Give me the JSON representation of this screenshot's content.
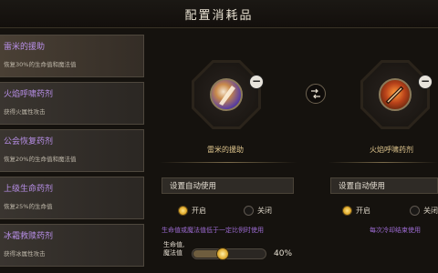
{
  "title": "配置消耗品",
  "consumables": [
    {
      "name": "雷米的援助",
      "desc": "恢复30%的生命值和魔法值"
    },
    {
      "name": "火焰呼啸药剂",
      "desc": "获得火属性攻击"
    },
    {
      "name": "公会恢复药剂",
      "desc": "恢复20%的生命值和魔法值"
    },
    {
      "name": "上级生命药剂",
      "desc": "恢复25%的生命值"
    },
    {
      "name": "冰霜救赎药剂",
      "desc": "获得冰属性攻击"
    }
  ],
  "slot1": {
    "name": "雷米的援助",
    "auto_label": "设置自动使用",
    "on_label": "开启",
    "off_label": "关闭",
    "selected": "on",
    "hint": "生命值或魔法值低于一定比例时使用",
    "threshold_label_line1": "生命值,",
    "threshold_label_line2": "魔法值",
    "threshold_value": "40%",
    "threshold_fraction": 0.4
  },
  "slot2": {
    "name": "火焰呼啸药剂",
    "auto_label": "设置自动使用",
    "on_label": "开启",
    "off_label": "关闭",
    "selected": "on",
    "hint": "每次冷却结束使用"
  },
  "icons": {
    "remove": "minus-icon",
    "swap": "swap-arrows-icon"
  },
  "colors": {
    "item_name": "#b88fe8",
    "slot_name": "#e0c68e",
    "hint": "#9b6ad0",
    "radio_on": "#e0a92a"
  }
}
